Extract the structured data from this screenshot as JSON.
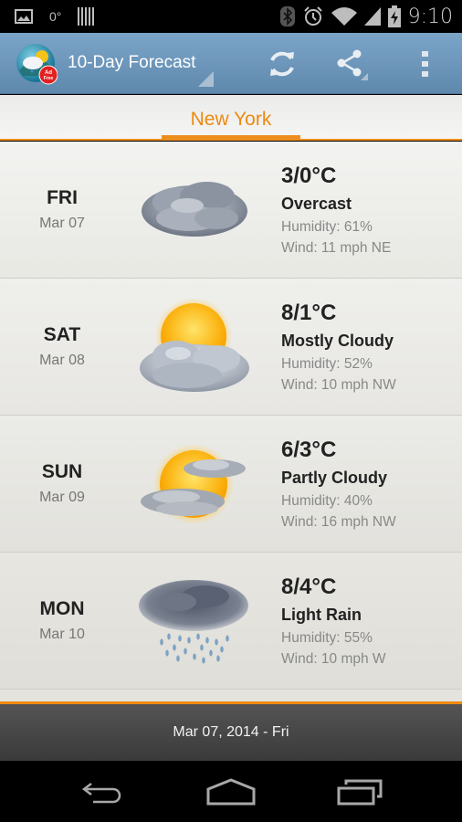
{
  "status_bar": {
    "temperature": "0°",
    "time": "9:10",
    "icons_left": [
      "image-notification-icon",
      "temperature-notification",
      "barcode-notification-icon"
    ],
    "icons_right": [
      "bluetooth-icon",
      "alarm-icon",
      "wifi-icon",
      "cell-signal-icon",
      "battery-charging-icon"
    ]
  },
  "action_bar": {
    "app_icon_badge": "Ad Free",
    "title": "10-Day Forecast",
    "actions": [
      "refresh",
      "share",
      "overflow-menu"
    ]
  },
  "location_tab": {
    "label": "New York",
    "accent_color": "#ec8a10"
  },
  "forecast": [
    {
      "day": "FRI",
      "date": "Mar 07",
      "icon": "overcast",
      "temp": "3/0°C",
      "condition": "Overcast",
      "humidity": "Humidity: 61%",
      "wind": "Wind: 11 mph NE"
    },
    {
      "day": "SAT",
      "date": "Mar 08",
      "icon": "mostly-cloudy",
      "temp": "8/1°C",
      "condition": "Mostly Cloudy",
      "humidity": "Humidity: 52%",
      "wind": "Wind: 10 mph NW"
    },
    {
      "day": "SUN",
      "date": "Mar 09",
      "icon": "partly-cloudy",
      "temp": "6/3°C",
      "condition": "Partly Cloudy",
      "humidity": "Humidity: 40%",
      "wind": "Wind: 16 mph NW"
    },
    {
      "day": "MON",
      "date": "Mar 10",
      "icon": "light-rain",
      "temp": "8/4°C",
      "condition": "Light Rain",
      "humidity": "Humidity: 55%",
      "wind": "Wind: 10 mph W"
    }
  ],
  "date_bar": {
    "label": "Mar 07, 2014 - Fri"
  },
  "nav_bar": {
    "buttons": [
      "back",
      "home",
      "recent-apps"
    ]
  },
  "colors": {
    "action_bar": "#6f98bd",
    "accent": "#ec8a10",
    "date_bar": "#484848"
  }
}
